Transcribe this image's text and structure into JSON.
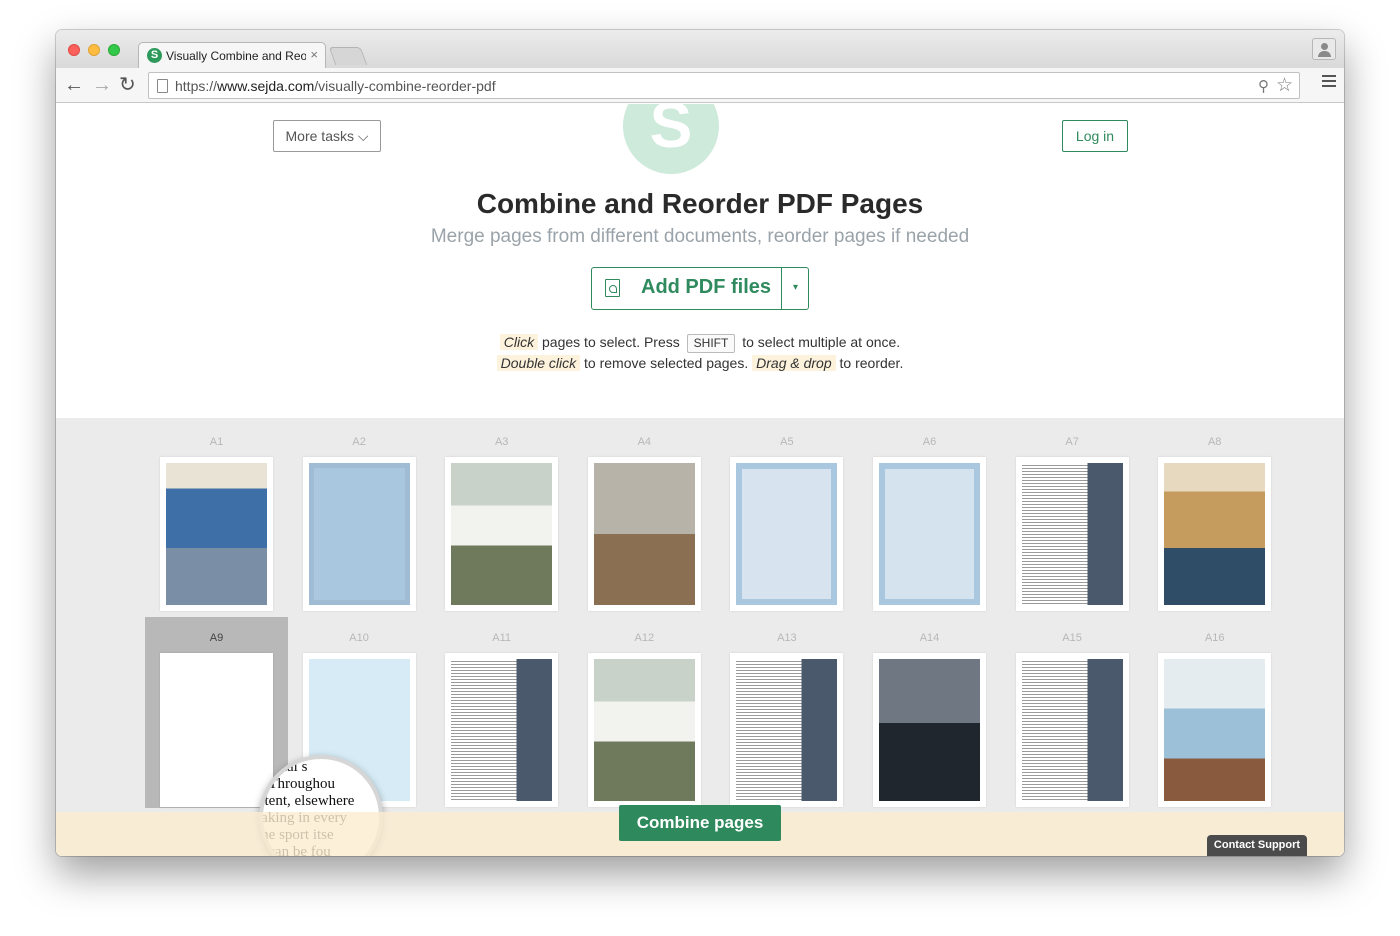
{
  "browser": {
    "tab_title": "Visually Combine and Reor",
    "tab_close": "×",
    "favicon_letter": "S",
    "url_prefix": "https://",
    "url_domain": "www.sejda.com",
    "url_path": "/visually-combine-reorder-pdf"
  },
  "header": {
    "more_tasks_label": "More tasks ⌵",
    "login_label": "Log in",
    "logo_letter": "S"
  },
  "hero": {
    "title": "Combine and Reorder PDF Pages",
    "subtitle": "Merge pages from different documents, reorder pages if needed",
    "add_button_label": "Add PDF files",
    "add_caret": "▾"
  },
  "instructions": {
    "click": "Click",
    "line1_a": "pages to select. Press",
    "shift_key": "SHIFT",
    "line1_b": "to select multiple at once.",
    "double_click": "Double click",
    "line2_a": "to remove selected pages.",
    "drag_drop": "Drag & drop",
    "line2_b": "to reorder."
  },
  "pages": [
    {
      "label": "A1",
      "style": "cover-sailing"
    },
    {
      "label": "A2",
      "style": "title-blue"
    },
    {
      "label": "A3",
      "style": "photo-sails"
    },
    {
      "label": "A4",
      "style": "photo-title"
    },
    {
      "label": "A5",
      "style": "contents"
    },
    {
      "label": "A6",
      "style": "text-images"
    },
    {
      "label": "A7",
      "style": "text-photo"
    },
    {
      "label": "A8",
      "style": "photo-yacht"
    },
    {
      "label": "A9",
      "style": "text",
      "selected": true
    },
    {
      "label": "A10",
      "style": "diagram-boats"
    },
    {
      "label": "A11",
      "style": "text-photo"
    },
    {
      "label": "A12",
      "style": "photo-sails"
    },
    {
      "label": "A13",
      "style": "text-photo"
    },
    {
      "label": "A14",
      "style": "photo-dark"
    },
    {
      "label": "A15",
      "style": "text-photo"
    },
    {
      "label": "A16",
      "style": "photo-color"
    }
  ],
  "magnifier_lines": [
    "ational s",
    "l. Throughou",
    "xtent, elsewhere",
    "taking in every",
    "the sport itse",
    "h can be fou",
    "aking"
  ],
  "footer": {
    "combine_label": "Combine pages",
    "support_label": "Contact Support"
  },
  "colors": {
    "accent": "#2e8a5d",
    "footer_bg": "#fdecd0",
    "grid_bg": "#ebebeb"
  }
}
